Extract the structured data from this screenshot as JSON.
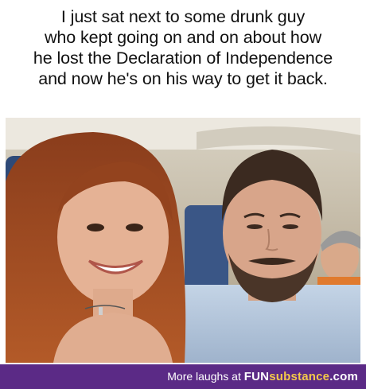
{
  "caption": {
    "lines": [
      "I just sat next to some drunk guy",
      "who kept going on and on about how",
      "he lost the Declaration of Independence",
      "and now he's on his way to get it back."
    ]
  },
  "footer": {
    "prefix": "More laughs at",
    "brand_part1": "FUN",
    "brand_part2": "substance",
    "brand_suffix": ".com"
  },
  "colors": {
    "footer_bg": "#5b2a86",
    "brand_accent": "#f3c94a"
  }
}
